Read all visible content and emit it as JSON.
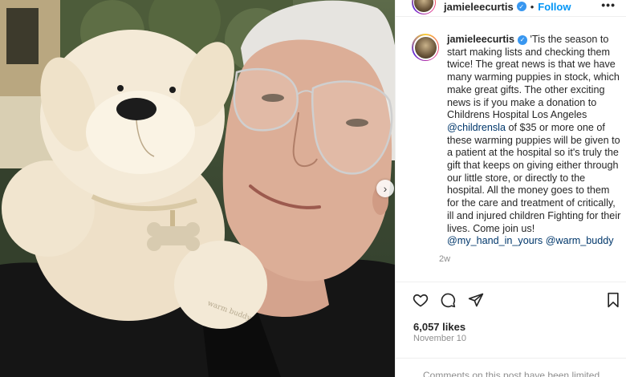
{
  "post": {
    "username": "jamieleecurtis",
    "verified_glyph": "✓",
    "dot": "•",
    "follow_label": "Follow",
    "more_glyph": "•••",
    "caption_parts": {
      "text1": "'Tis the season to start making lists and checking them twice! The great news is that we have many warming puppies in stock, which make great gifts. The other exciting news is if you make a donation to Childrens Hospital Los Angeles ",
      "mention1": "@childrensla",
      "text2": " of $35 or more one of these warming puppies will be given to a patient at the hospital so it's truly the gift that keeps on giving either through our little store, or directly to the hospital. All the money goes to them for the care and treatment of critically, ill and injured children Fighting for their lives. Come join us! ",
      "mention2": "@my_hand_in_yours",
      "space": " ",
      "mention3": "@warm_buddy"
    },
    "time_ago": "2w",
    "likes": "6,057 likes",
    "date": "November 10",
    "comments_notice": "Comments on this post have been limited."
  },
  "media": {
    "next_arrow_glyph": "›",
    "tag_text": "warm buddy"
  },
  "icons": {
    "like": "heart-icon",
    "comment": "comment-icon",
    "share": "share-icon",
    "save": "bookmark-icon"
  },
  "colors": {
    "accent": "#0095f6",
    "mention": "#00376b",
    "verified": "#3897f0",
    "text": "#262626",
    "muted": "#8e8e8e",
    "divider": "#efefef"
  }
}
